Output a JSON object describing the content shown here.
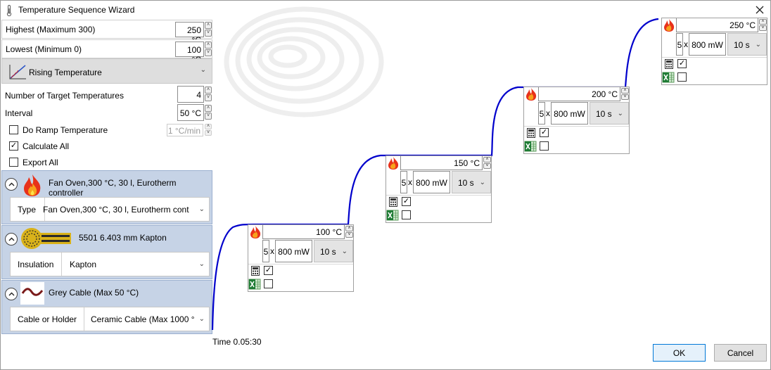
{
  "window": {
    "title": "Temperature Sequence Wizard"
  },
  "highest": {
    "label": "Highest (Maximum 300)",
    "value": "250 °C"
  },
  "lowest": {
    "label": "Lowest (Minimum 0)",
    "value": "100 °C"
  },
  "profile": {
    "label": "Rising Temperature"
  },
  "target_count": {
    "label": "Number of Target Temperatures",
    "value": "4"
  },
  "interval": {
    "label": "Interval",
    "value": "50 °C"
  },
  "ramp": {
    "label": "Do Ramp Temperature",
    "checked": false,
    "value": "1 °C/min"
  },
  "calculate_all": {
    "label": "Calculate All",
    "checked": true
  },
  "export_all": {
    "label": "Export All",
    "checked": false
  },
  "devices": [
    {
      "name": "Fan Oven,300 °C, 30 l, Eurotherm controller",
      "field_label": "Type",
      "field_value": "Fan Oven,300 °C, 30 l, Eurotherm cont",
      "icon": "fan-oven-flame-icon"
    },
    {
      "name": "5501   6.403 mm Kapton",
      "field_label": "Insulation",
      "field_value": "Kapton",
      "icon": "sensor-kapton-icon"
    },
    {
      "name": "Grey Cable (Max 50 °C)",
      "field_label": "Cable or Holder",
      "field_value": "Ceramic Cable (Max 1000 °",
      "icon": "cable-icon"
    }
  ],
  "steps": [
    {
      "temp": "100 °C",
      "repeat": "5",
      "x": "x",
      "power": "800 mW",
      "duration": "10 s",
      "calculate": true,
      "export": false
    },
    {
      "temp": "150 °C",
      "repeat": "5",
      "x": "x",
      "power": "800 mW",
      "duration": "10 s",
      "calculate": true,
      "export": false
    },
    {
      "temp": "200 °C",
      "repeat": "5",
      "x": "x",
      "power": "800 mW",
      "duration": "10 s",
      "calculate": true,
      "export": false
    },
    {
      "temp": "250 °C",
      "repeat": "5",
      "x": "x",
      "power": "800 mW",
      "duration": "10 s",
      "calculate": true,
      "export": false
    }
  ],
  "time_label": "Time 0.05:30",
  "buttons": {
    "ok": "OK",
    "cancel": "Cancel"
  },
  "colors": {
    "curve": "#0000cc",
    "panel": "#c6d3e6",
    "accent": "#0078d7"
  }
}
